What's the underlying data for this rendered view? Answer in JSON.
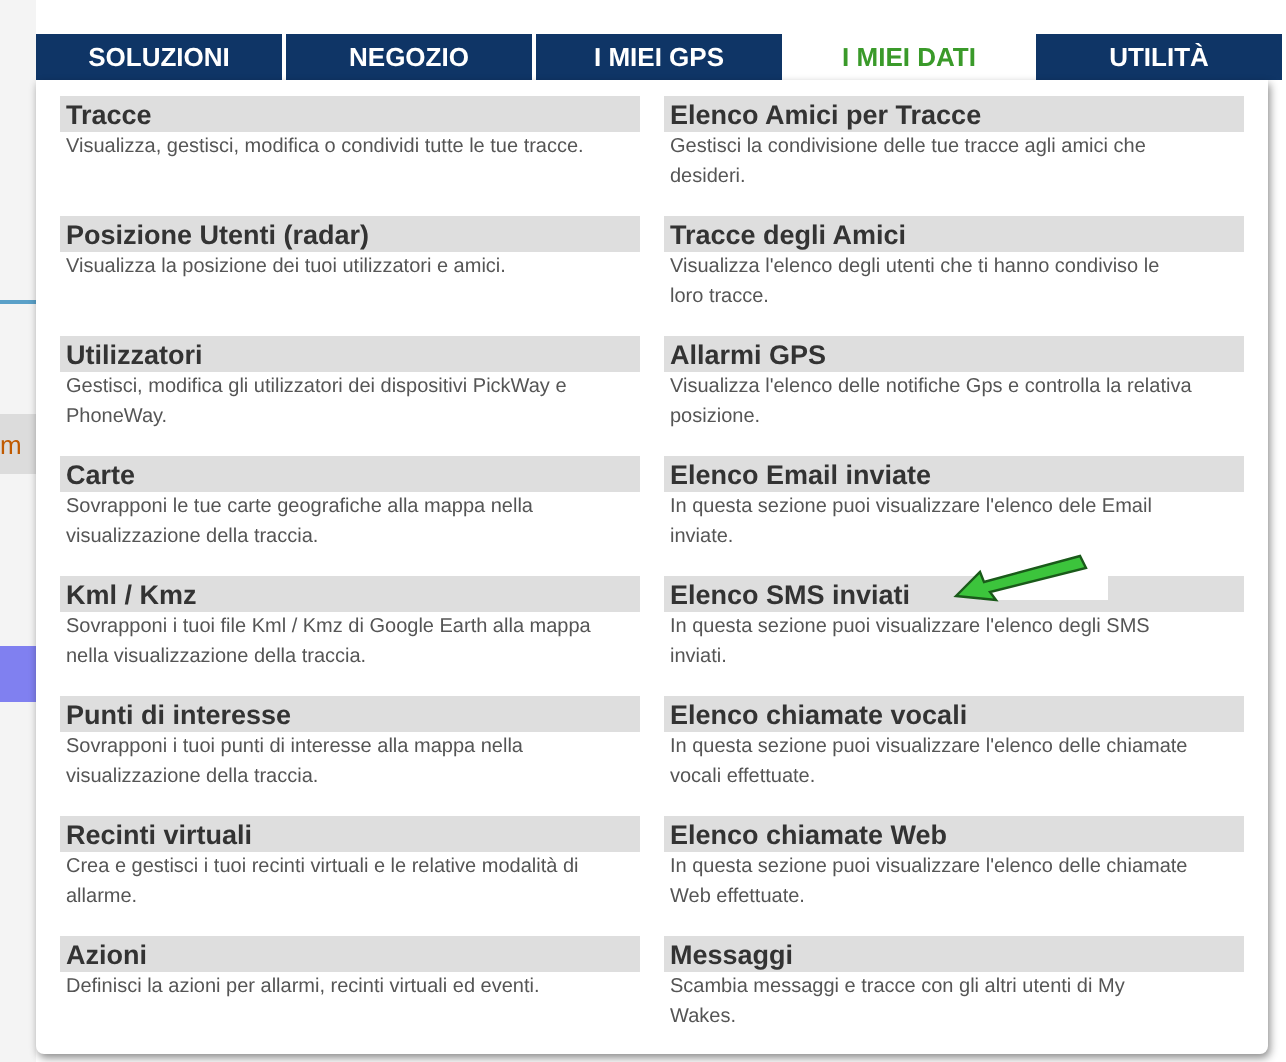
{
  "background_text": "m",
  "tabs": [
    {
      "label": "SOLUZIONI",
      "selected": false
    },
    {
      "label": "NEGOZIO",
      "selected": false
    },
    {
      "label": "I MIEI GPS",
      "selected": false
    },
    {
      "label": "I MIEI DATI",
      "selected": true
    },
    {
      "label": "UTILITÀ",
      "selected": false
    }
  ],
  "columns": [
    [
      {
        "title": "Tracce",
        "description": "Visualizza, gestisci, modifica o condividi tutte le tue tracce."
      },
      {
        "title": "Posizione Utenti (radar)",
        "description": "Visualizza la posizione dei tuoi utilizzatori e amici."
      },
      {
        "title": "Utilizzatori",
        "description": "Gestisci, modifica gli utilizzatori dei dispositivi PickWay e PhoneWay."
      },
      {
        "title": "Carte",
        "description": "Sovrapponi le tue carte geografiche alla mappa nella visualizzazione della traccia."
      },
      {
        "title": "Kml / Kmz",
        "description": "Sovrapponi i tuoi file Kml / Kmz di Google Earth alla mappa nella visualizzazione della traccia."
      },
      {
        "title": "Punti di interesse",
        "description": "Sovrapponi i tuoi punti di interesse alla mappa nella visualizzazione della traccia."
      },
      {
        "title": "Recinti virtuali",
        "description": "Crea e gestisci i tuoi recinti virtuali e le relative modalità di allarme."
      },
      {
        "title": "Azioni",
        "description": "Definisci la azioni per allarmi, recinti virtuali ed eventi."
      }
    ],
    [
      {
        "title": "Elenco Amici per Tracce",
        "description": "Gestisci la condivisione delle tue tracce agli amici che desideri."
      },
      {
        "title": "Tracce degli Amici",
        "description": "Visualizza l'elenco degli utenti che ti hanno condiviso le loro tracce."
      },
      {
        "title": "Allarmi GPS",
        "description": "Visualizza l'elenco delle notifiche Gps e controlla la relativa posizione."
      },
      {
        "title": "Elenco Email inviate",
        "description": "In questa sezione puoi visualizzare l'elenco dele Email inviate."
      },
      {
        "title": "Elenco SMS inviati",
        "description": "In questa sezione puoi visualizzare l'elenco degli SMS inviati."
      },
      {
        "title": "Elenco chiamate vocali",
        "description": "In questa sezione puoi visualizzare l'elenco delle chiamate vocali effettuate."
      },
      {
        "title": "Elenco chiamate Web",
        "description": "In questa sezione puoi visualizzare l'elenco delle chiamate Web effettuate."
      },
      {
        "title": "Messaggi",
        "description": "Scambia messaggi e tracce con gli altri utenti di My Wakes."
      }
    ]
  ]
}
